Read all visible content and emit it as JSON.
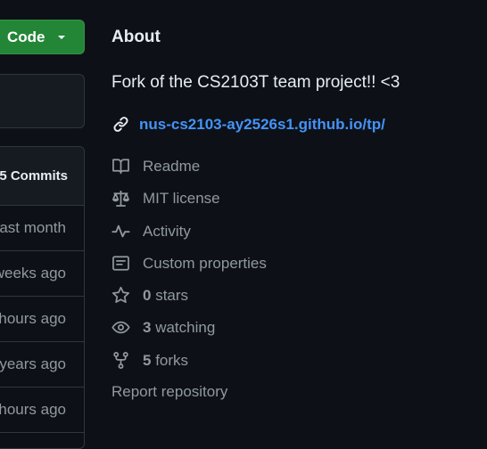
{
  "code_button": {
    "label": "Code",
    "icon": "chevron-down-icon"
  },
  "commits": {
    "header": "5 Commits",
    "rows": [
      "last month",
      "weeks ago",
      "hours ago",
      "years ago",
      "hours ago"
    ]
  },
  "about": {
    "title": "About",
    "description": "Fork of the CS2103T team project!! <3",
    "link": {
      "icon": "link-icon",
      "text": "nus-cs2103-ay2526s1.github.io/tp/"
    },
    "readme": {
      "icon": "book-icon",
      "label": "Readme"
    },
    "license": {
      "icon": "law-icon",
      "label": "MIT license"
    },
    "activity": {
      "icon": "pulse-icon",
      "label": "Activity"
    },
    "custom_properties": {
      "icon": "note-icon",
      "label": "Custom properties"
    },
    "stars": {
      "icon": "star-icon",
      "count": "0",
      "label": "stars"
    },
    "watching": {
      "icon": "eye-icon",
      "count": "3",
      "label": "watching"
    },
    "forks": {
      "icon": "repo-forked-icon",
      "count": "5",
      "label": "forks"
    },
    "report": "Report repository"
  },
  "colors": {
    "background": "#0d1117",
    "accent_link": "#4493f8",
    "muted_text": "#9198a1",
    "button_green": "#238636"
  }
}
